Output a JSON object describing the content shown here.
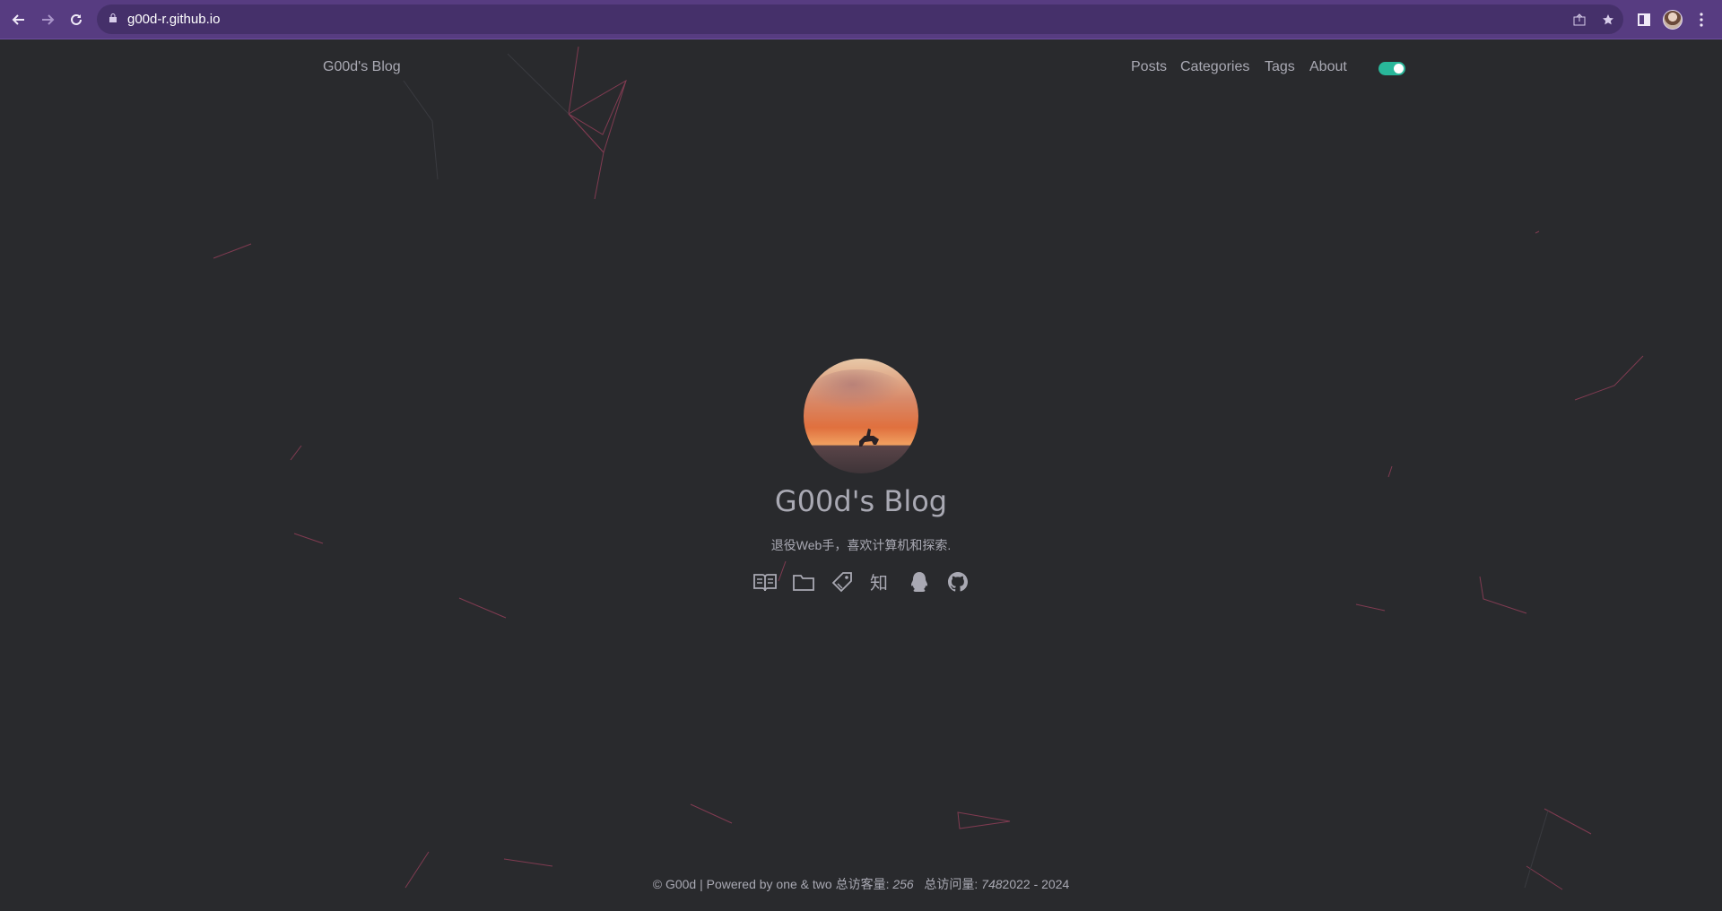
{
  "browser": {
    "url": "g00d-r.github.io"
  },
  "header": {
    "logo": "G00d's Blog",
    "nav": [
      {
        "label": "Posts"
      },
      {
        "label": "Categories"
      },
      {
        "label": "Tags"
      },
      {
        "label": "About"
      }
    ],
    "theme_toggle_on": true,
    "accent": "#29b79a"
  },
  "profile": {
    "title": "G00d's Blog",
    "subtitle": "退役Web手，喜欢计算机和探索.",
    "social_icons": [
      "book-icon",
      "folder-icon",
      "tag-icon",
      "zhihu-icon",
      "qq-icon",
      "github-icon"
    ]
  },
  "footer": {
    "copyright": "© G00d | Powered by one & two",
    "visitors_label": "总访客量:",
    "visitors_value": "256",
    "views_label": "总访问量:",
    "views_value": "748",
    "years": "2022 - 2024"
  },
  "colors": {
    "background": "#292a2d",
    "browser_frame": "#573c81",
    "text": "#a9a9b3"
  }
}
